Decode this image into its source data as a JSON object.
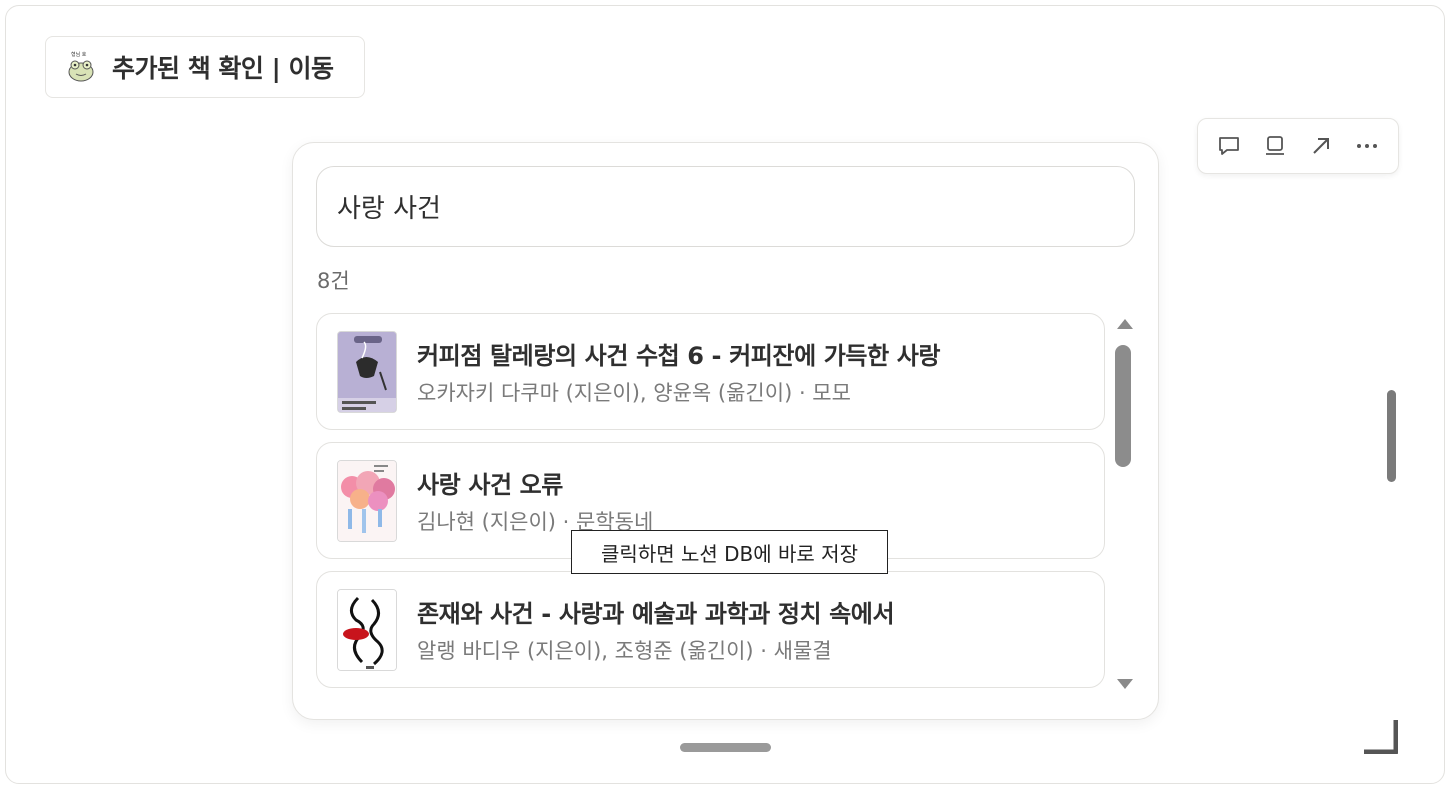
{
  "header": {
    "title": "추가된 책 확인 | 이동",
    "emoji_text": "형님 호"
  },
  "search": {
    "value": "사랑 사건"
  },
  "results": {
    "count": "8건",
    "items": [
      {
        "title": "커피점 탈레랑의 사건 수첩 6 - 커피잔에 가득한 사랑",
        "meta": "오카자키 다쿠마 (지은이), 양윤옥 (옮긴이) · 모모"
      },
      {
        "title": "사랑 사건 오류",
        "meta": "김나현 (지은이) · 문학동네"
      },
      {
        "title": "존재와 사건 - 사랑과 예술과 과학과 정치 속에서",
        "meta": "알랭 바디우 (지은이), 조형준 (옮긴이) · 새물결"
      }
    ]
  },
  "tooltip": {
    "text": "클릭하면 노션 DB에 바로 저장"
  },
  "toolbar": {
    "icons": [
      "comment-icon",
      "layout-icon",
      "open-arrow-icon",
      "more-icon"
    ]
  }
}
